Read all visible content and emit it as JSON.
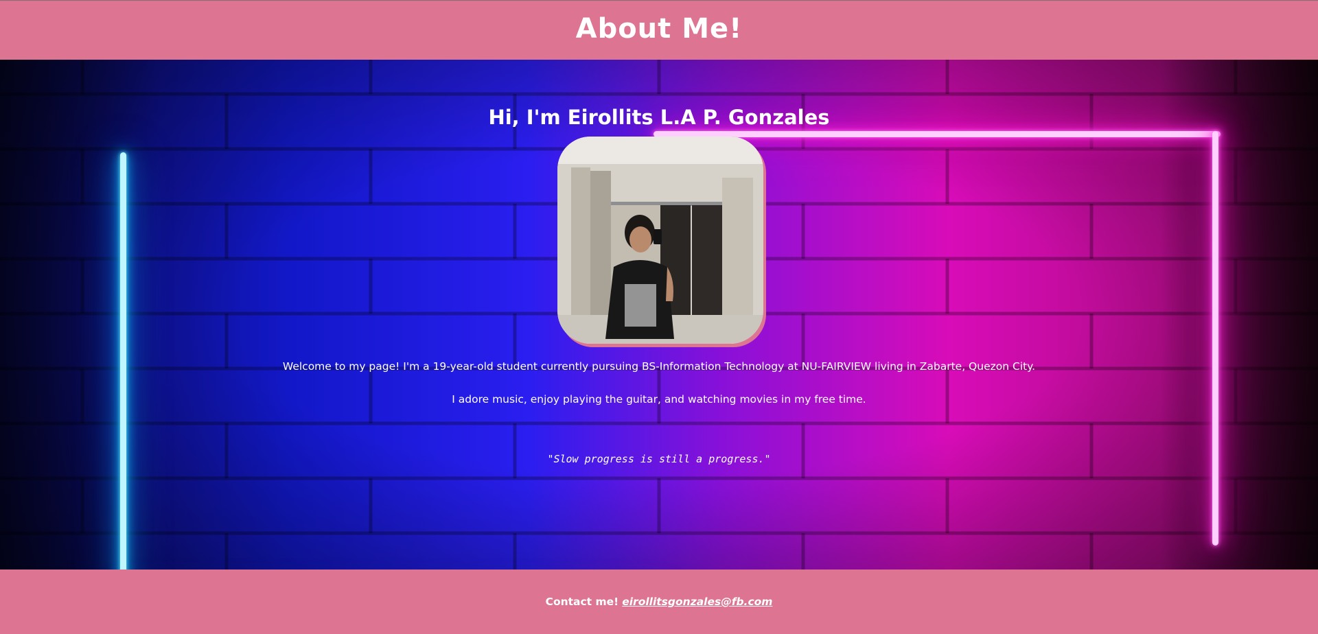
{
  "header": {
    "title": "About Me!"
  },
  "main": {
    "greeting": "Hi, I'm Eirollits L.A P. Gonzales",
    "photo_alt": "Mirror selfie photo",
    "intro": "Welcome to my page! I'm a 19-year-old student currently pursuing BS-Information Technology at NU-FAIRVIEW living in Zabarte, Quezon City.",
    "hobbies": "I adore music, enjoy playing the guitar, and watching movies in my free time.",
    "quote": "\"Slow progress is still a progress.\""
  },
  "footer": {
    "contact_label": "Contact me!",
    "email": "eirollitsgonzales@fb.com"
  },
  "colors": {
    "accent": "#dc7492",
    "neon_cyan": "#14c8ff",
    "neon_pink": "#ff28e0"
  }
}
